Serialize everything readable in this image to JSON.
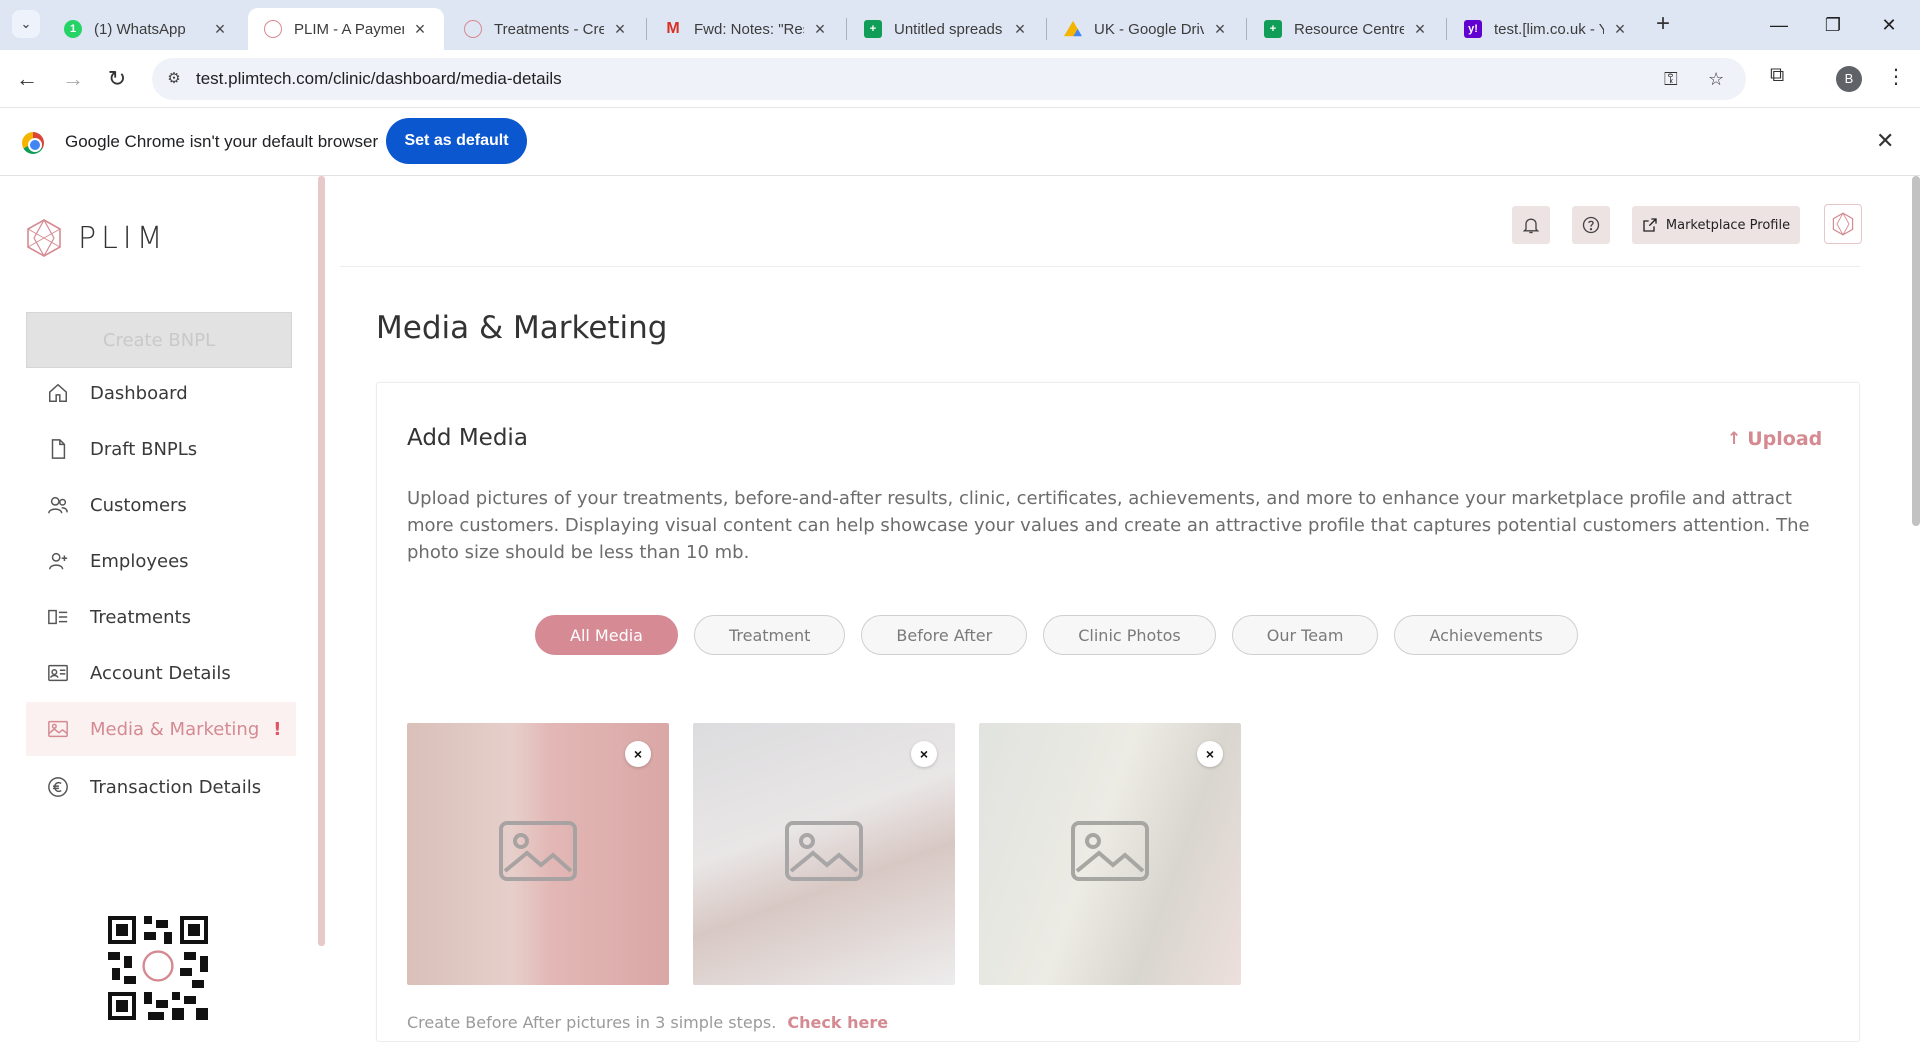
{
  "browser": {
    "tabs": [
      {
        "label": "(1) WhatsApp",
        "icon": "whatsapp-icon"
      },
      {
        "label": "PLIM - A Payment",
        "icon": "plim-icon"
      },
      {
        "label": "Treatments - Cre",
        "icon": "plim-icon"
      },
      {
        "label": "Fwd: Notes: \"Res",
        "icon": "gmail-icon"
      },
      {
        "label": "Untitled spreads",
        "icon": "sheets-icon"
      },
      {
        "label": "UK - Google Driv",
        "icon": "drive-icon"
      },
      {
        "label": "Resource Centre",
        "icon": "sheets-icon"
      },
      {
        "label": "test.[lim.co.uk - Y",
        "icon": "yahoo-icon"
      }
    ],
    "url": "test.plimtech.com/clinic/dashboard/media-details",
    "profile_initial": "B",
    "infobar_message": "Google Chrome isn't your default browser",
    "set_default_label": "Set as default"
  },
  "sidebar": {
    "brand": "PLIM",
    "create_label": "Create BNPL",
    "items": [
      {
        "label": "Dashboard",
        "icon": "home-icon"
      },
      {
        "label": "Draft BNPLs",
        "icon": "document-icon"
      },
      {
        "label": "Customers",
        "icon": "users-icon"
      },
      {
        "label": "Employees",
        "icon": "user-add-icon"
      },
      {
        "label": "Treatments",
        "icon": "treatments-icon"
      },
      {
        "label": "Account Details",
        "icon": "id-card-icon"
      },
      {
        "label": "Media & Marketing",
        "icon": "image-icon",
        "alert": "!"
      },
      {
        "label": "Transaction Details",
        "icon": "euro-icon"
      }
    ]
  },
  "topbar": {
    "marketplace_label": "Marketplace Profile"
  },
  "page": {
    "title": "Media & Marketing",
    "card_title": "Add Media",
    "upload_label": "Upload",
    "description": "Upload pictures of your treatments, before-and-after results, clinic, certificates, achievements, and more to enhance your marketplace profile and attract more customers. Displaying visual content can help showcase your values and create an attractive profile that captures potential customers attention. The photo size should be less than 10 mb.",
    "filters": [
      "All Media",
      "Treatment",
      "Before After",
      "Clinic Photos",
      "Our Team",
      "Achievements"
    ],
    "active_filter": "All Media",
    "remove_symbol": "×",
    "bottom_note": "Create Before After pictures in 3 simple steps.",
    "bottom_link": "Check here"
  },
  "colors": {
    "accent": "#d68a94",
    "chrome_blue": "#0b57d0"
  }
}
